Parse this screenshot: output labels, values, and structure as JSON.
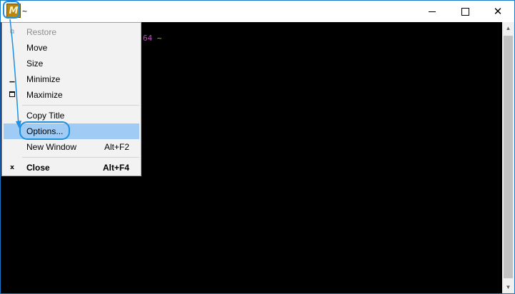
{
  "window": {
    "title": "~",
    "icon_letter": "M",
    "icon_name": "mintty-icon",
    "controls": {
      "minimize_icon": "minimize-icon",
      "maximize_icon": "maximize-icon",
      "close_glyph": "✕"
    }
  },
  "terminal": {
    "prompt_host_fragment": "64",
    "prompt_path": "~"
  },
  "system_menu": {
    "items": [
      {
        "label": "Restore",
        "shortcut": "",
        "icon": "restore-icon",
        "glyph": "⧉",
        "state": "disabled"
      },
      {
        "label": "Move",
        "shortcut": "",
        "icon": "",
        "glyph": "",
        "state": "normal"
      },
      {
        "label": "Size",
        "shortcut": "",
        "icon": "",
        "glyph": "",
        "state": "normal"
      },
      {
        "label": "Minimize",
        "shortcut": "",
        "icon": "minimize-icon",
        "glyph": "▁",
        "state": "normal"
      },
      {
        "label": "Maximize",
        "shortcut": "",
        "icon": "maximize-icon",
        "glyph": "",
        "state": "normal"
      },
      {
        "label": "Copy Title",
        "shortcut": "",
        "icon": "",
        "glyph": "",
        "state": "normal"
      },
      {
        "label": "Options...",
        "shortcut": "",
        "icon": "",
        "glyph": "",
        "state": "highlighted"
      },
      {
        "label": "New Window",
        "shortcut": "Alt+F2",
        "icon": "",
        "glyph": "",
        "state": "normal"
      },
      {
        "label": "Close",
        "shortcut": "Alt+F4",
        "icon": "close-icon",
        "glyph": "x",
        "state": "bold"
      }
    ]
  },
  "colors": {
    "highlight": "#9fcbf5",
    "callout": "#1e90e0",
    "prompt_host": "#c050c0",
    "prompt_path": "#c8b400",
    "icon_bg": "#b8860b"
  }
}
